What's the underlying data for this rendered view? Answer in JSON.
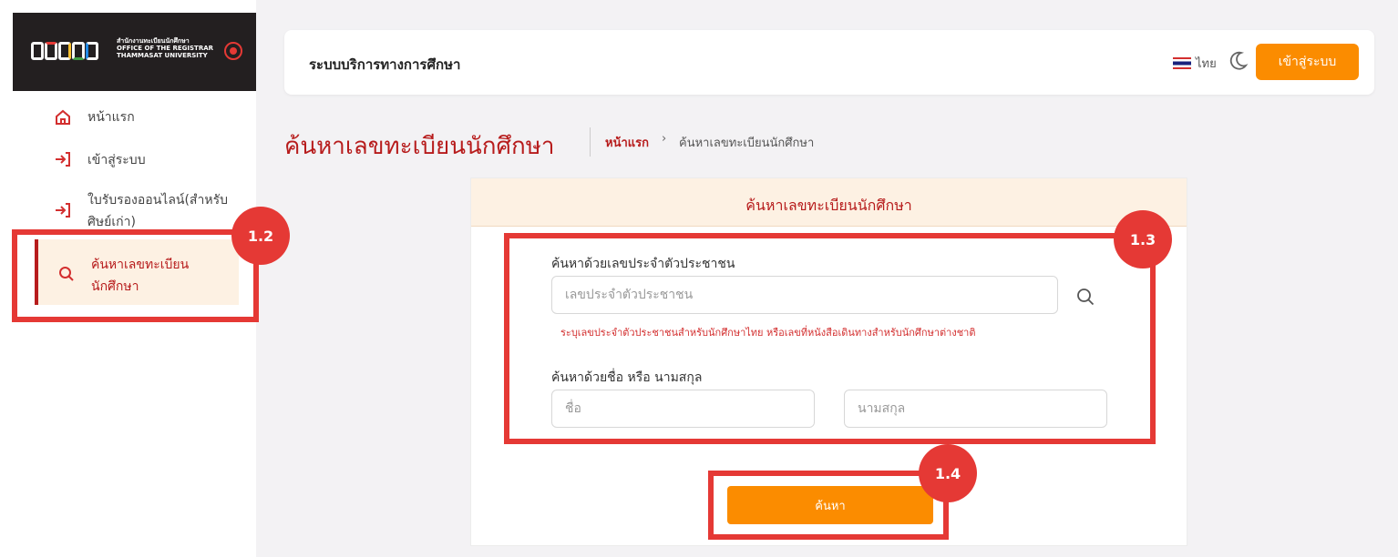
{
  "logo": {
    "mark": "REGTU",
    "thai": "สำนักงานทะเบียนนักศึกษา",
    "line1": "OFFICE OF THE REGISTRAR",
    "line2": "THAMMASAT UNIVERSITY"
  },
  "sidebar": {
    "items": [
      {
        "label": "หน้าแรก",
        "icon": "home-icon"
      },
      {
        "label": "เข้าสู่ระบบ",
        "icon": "login-icon"
      },
      {
        "label_line1": "ใบรับรองออนไลน์(สำหรับ",
        "label_line2": "ศิษย์เก่า)",
        "icon": "login-icon"
      },
      {
        "label_line1": "ค้นหาเลขทะเบียน",
        "label_line2": "นักศึกษา",
        "icon": "search-icon",
        "active": true
      }
    ]
  },
  "header": {
    "title": "ระบบบริการทางการศึกษา",
    "language": "ไทย",
    "login_label": "เข้าสู่ระบบ"
  },
  "page": {
    "title": "ค้นหาเลขทะเบียนนักศึกษา",
    "breadcrumb_home": "หน้าแรก",
    "breadcrumb_sep": "›",
    "breadcrumb_current": "ค้นหาเลขทะเบียนนักศึกษา"
  },
  "card": {
    "header": "ค้นหาเลขทะเบียนนักศึกษา",
    "id_label": "ค้นหาด้วยเลขประจำตัวประชาชน",
    "id_placeholder": "เลขประจำตัวประชาชน",
    "id_hint": "ระบุเลขประจำตัวประชาชนสำหรับนักศึกษาไทย หรือเลขที่หนังสือเดินทางสำหรับนักศึกษาต่างชาติ",
    "name_label": "ค้นหาด้วยชื่อ หรือ นามสกุล",
    "first_placeholder": "ชื่อ",
    "last_placeholder": "นามสกุล",
    "search_label": "ค้นหา"
  },
  "annotations": {
    "a1": "1.2",
    "a2": "1.3",
    "a3": "1.4"
  },
  "colors": {
    "brand_red": "#b71c1c",
    "accent_orange": "#fb8c00",
    "annotation_red": "#e53935"
  }
}
